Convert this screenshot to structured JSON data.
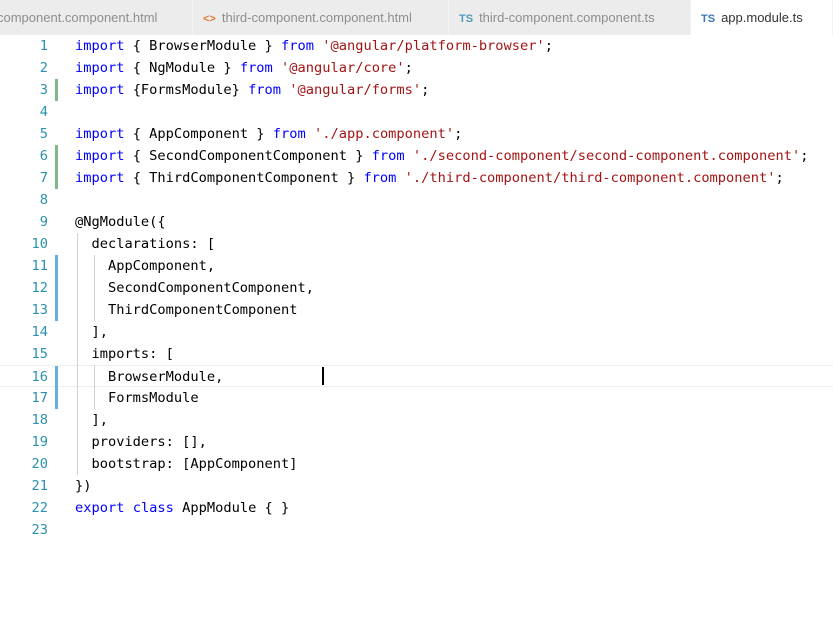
{
  "tabs": [
    {
      "label": "component.component.html",
      "icon": "html-icon",
      "icon_glyph": "",
      "active": false
    },
    {
      "label": "third-component.component.html",
      "icon": "html-icon",
      "icon_glyph": "<>",
      "active": false
    },
    {
      "label": "third-component.component.ts",
      "icon": "ts-icon",
      "icon_glyph": "TS",
      "active": false
    },
    {
      "label": "app.module.ts",
      "icon": "ts-icon",
      "icon_glyph": "TS",
      "active": true
    }
  ],
  "colors": {
    "keyword": "#0000ff",
    "string": "#a31515",
    "text": "#000000",
    "line_number": "#2b91af",
    "added": "#81b88b",
    "modified": "#66afe0"
  },
  "cursor": {
    "line": 16,
    "column": 32
  },
  "lines": [
    {
      "n": "1",
      "change": "",
      "tokens": [
        [
          "k",
          "import"
        ],
        [
          "t",
          " { BrowserModule } "
        ],
        [
          "k",
          "from"
        ],
        [
          "t",
          " "
        ],
        [
          "s",
          "'@angular/platform-browser'"
        ],
        [
          "t",
          ";"
        ]
      ]
    },
    {
      "n": "2",
      "change": "",
      "tokens": [
        [
          "k",
          "import"
        ],
        [
          "t",
          " { NgModule } "
        ],
        [
          "k",
          "from"
        ],
        [
          "t",
          " "
        ],
        [
          "s",
          "'@angular/core'"
        ],
        [
          "t",
          ";"
        ]
      ]
    },
    {
      "n": "3",
      "change": "added",
      "tokens": [
        [
          "k",
          "import"
        ],
        [
          "t",
          " {FormsModule} "
        ],
        [
          "k",
          "from"
        ],
        [
          "t",
          " "
        ],
        [
          "s",
          "'@angular/forms'"
        ],
        [
          "t",
          ";"
        ]
      ]
    },
    {
      "n": "4",
      "change": "",
      "tokens": []
    },
    {
      "n": "5",
      "change": "",
      "tokens": [
        [
          "k",
          "import"
        ],
        [
          "t",
          " { AppComponent } "
        ],
        [
          "k",
          "from"
        ],
        [
          "t",
          " "
        ],
        [
          "s",
          "'./app.component'"
        ],
        [
          "t",
          ";"
        ]
      ]
    },
    {
      "n": "6",
      "change": "added",
      "tokens": [
        [
          "k",
          "import"
        ],
        [
          "t",
          " { SecondComponentComponent } "
        ],
        [
          "k",
          "from"
        ],
        [
          "t",
          " "
        ],
        [
          "s",
          "'./second-component/second-component.component'"
        ],
        [
          "t",
          ";"
        ]
      ]
    },
    {
      "n": "7",
      "change": "added",
      "tokens": [
        [
          "k",
          "import"
        ],
        [
          "t",
          " { ThirdComponentComponent } "
        ],
        [
          "k",
          "from"
        ],
        [
          "t",
          " "
        ],
        [
          "s",
          "'./third-component/third-component.component'"
        ],
        [
          "t",
          ";"
        ]
      ]
    },
    {
      "n": "8",
      "change": "",
      "tokens": []
    },
    {
      "n": "9",
      "change": "",
      "tokens": [
        [
          "t",
          "@NgModule({"
        ]
      ]
    },
    {
      "n": "10",
      "change": "",
      "tokens": [
        [
          "t",
          "  declarations: ["
        ]
      ]
    },
    {
      "n": "11",
      "change": "modified",
      "tokens": [
        [
          "t",
          "    AppComponent,"
        ]
      ]
    },
    {
      "n": "12",
      "change": "modified",
      "tokens": [
        [
          "t",
          "    SecondComponentComponent,"
        ]
      ]
    },
    {
      "n": "13",
      "change": "modified",
      "tokens": [
        [
          "t",
          "    ThirdComponentComponent"
        ]
      ]
    },
    {
      "n": "14",
      "change": "",
      "tokens": [
        [
          "t",
          "  ],"
        ]
      ]
    },
    {
      "n": "15",
      "change": "",
      "tokens": [
        [
          "t",
          "  imports: ["
        ]
      ]
    },
    {
      "n": "16",
      "change": "modified",
      "tokens": [
        [
          "t",
          "    BrowserModule,"
        ]
      ]
    },
    {
      "n": "17",
      "change": "modified",
      "tokens": [
        [
          "t",
          "    FormsModule"
        ]
      ]
    },
    {
      "n": "18",
      "change": "",
      "tokens": [
        [
          "t",
          "  ],"
        ]
      ]
    },
    {
      "n": "19",
      "change": "",
      "tokens": [
        [
          "t",
          "  providers: [],"
        ]
      ]
    },
    {
      "n": "20",
      "change": "",
      "tokens": [
        [
          "t",
          "  bootstrap: [AppComponent]"
        ]
      ]
    },
    {
      "n": "21",
      "change": "",
      "tokens": [
        [
          "t",
          "})"
        ]
      ]
    },
    {
      "n": "22",
      "change": "",
      "tokens": [
        [
          "k",
          "export"
        ],
        [
          "t",
          " "
        ],
        [
          "k",
          "class"
        ],
        [
          "t",
          " AppModule { }"
        ]
      ]
    },
    {
      "n": "23",
      "change": "",
      "tokens": []
    }
  ]
}
